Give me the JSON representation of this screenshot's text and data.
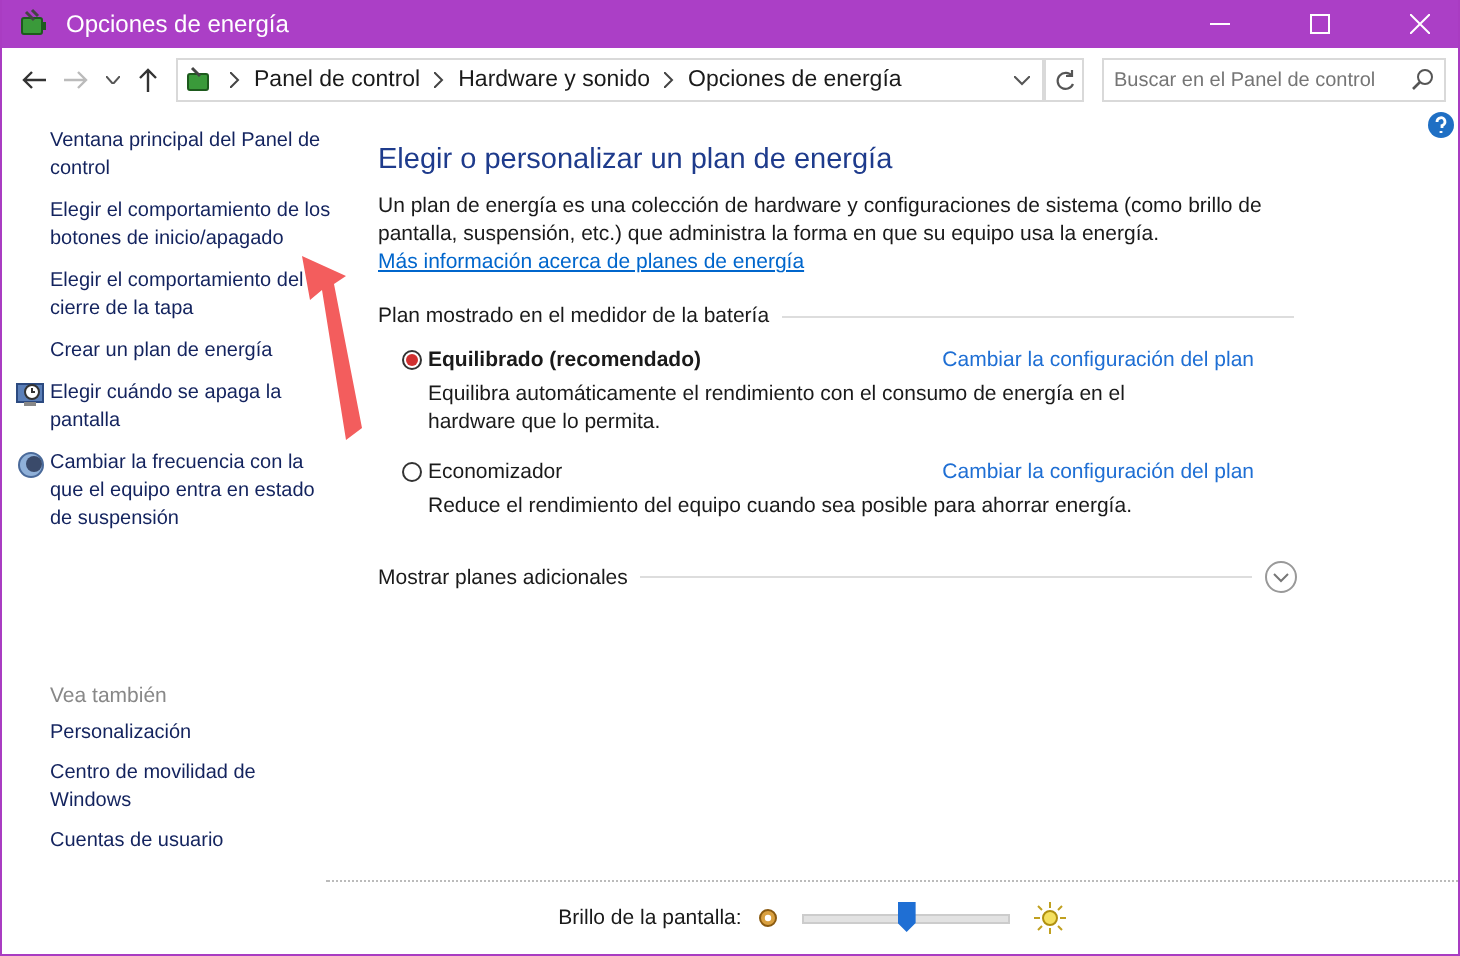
{
  "window": {
    "title": "Opciones de energía"
  },
  "address_bar": {
    "breadcrumbs": [
      "Panel de control",
      "Hardware y sonido",
      "Opciones de energía"
    ]
  },
  "search": {
    "placeholder": "Buscar en el Panel de control"
  },
  "sidebar": {
    "items": [
      {
        "label": "Ventana principal del Panel de control"
      },
      {
        "label": "Elegir el comportamiento de los botones de inicio/apagado"
      },
      {
        "label": "Elegir el comportamiento del cierre de la tapa"
      },
      {
        "label": "Crear un plan de energía"
      },
      {
        "label": "Elegir cuándo se apaga la pantalla"
      },
      {
        "label": "Cambiar la frecuencia con la que el equipo entra en estado de suspensión"
      }
    ],
    "see_also_heading": "Vea también",
    "see_also": [
      "Personalización",
      "Centro de movilidad de Windows",
      "Cuentas de usuario"
    ]
  },
  "main": {
    "title": "Elegir o personalizar un plan de energía",
    "description": "Un plan de energía es una colección de hardware y configuraciones de sistema (como brillo de pantalla, suspensión, etc.) que administra la forma en que su equipo usa la energía.",
    "description_link": "Más información acerca de planes de energía",
    "group_label": "Plan mostrado en el medidor de la batería",
    "plans": [
      {
        "name": "Equilibrado (recomendado)",
        "selected": true,
        "link": "Cambiar la configuración del plan",
        "description": "Equilibra automáticamente el rendimiento con el consumo de energía en el hardware que lo permita."
      },
      {
        "name": "Economizador",
        "selected": false,
        "link": "Cambiar la configuración del plan",
        "description": "Reduce el rendimiento del equipo cuando sea posible para ahorrar energía."
      }
    ],
    "more_plans": "Mostrar planes adicionales"
  },
  "brightness": {
    "label": "Brillo de la pantalla:",
    "level": 0.5
  }
}
